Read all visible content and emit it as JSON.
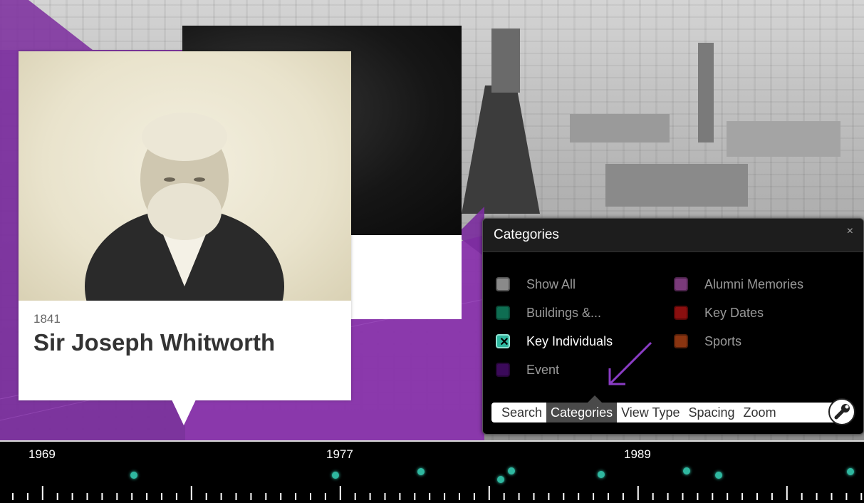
{
  "card": {
    "year": "1841",
    "title": "Sir Joseph Whitworth"
  },
  "panel": {
    "title": "Categories",
    "close": "×",
    "categories": [
      {
        "label": "Show All",
        "color": "#8a8a8a",
        "checked": false
      },
      {
        "label": "Buildings &...",
        "color": "#0e6e52",
        "checked": false
      },
      {
        "label": "Key Individuals",
        "color": "#2fb8a0",
        "checked": true
      },
      {
        "label": "Event",
        "color": "#3b0a5a",
        "checked": false
      },
      {
        "label": "Alumni Memories",
        "color": "#7a3a7a",
        "checked": false
      },
      {
        "label": "Key Dates",
        "color": "#8a0f0f",
        "checked": false
      },
      {
        "label": "Sports",
        "color": "#8a3410",
        "checked": false
      }
    ],
    "tabs": [
      "Search",
      "Categories",
      "View Type",
      "Spacing",
      "Zoom"
    ],
    "active_tab": "Categories",
    "settings_icon": "wrench-icon"
  },
  "timeline": {
    "years": [
      "1969",
      "1977",
      "1989"
    ]
  },
  "colors": {
    "accent_purple": "#7b2c9e",
    "dot_teal": "#2fb8a0"
  }
}
